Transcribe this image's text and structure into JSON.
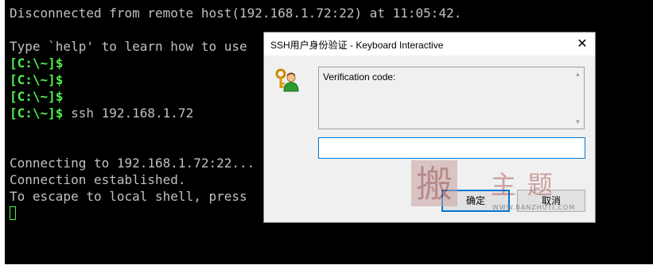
{
  "terminal": {
    "lines": [
      "Disconnected from remote host(192.168.1.72:22) at 11:05:42.",
      "",
      "Type `help' to learn how to use Xshell prompt.",
      "[C:\\~]$",
      "[C:\\~]$",
      "[C:\\~]$",
      "[C:\\~]$ ssh 192.168.1.72",
      "",
      "",
      "Connecting to 192.168.1.72:22...",
      "Connection established.",
      "To escape to local shell, press 'Ctrl+Alt+]'."
    ],
    "prompt": "[C:\\~]$",
    "ssh_command": " ssh 192.168.1.72",
    "line_disconnected": "Disconnected from remote host(192.168.1.72:22) at 11:05:42.",
    "line_help": "Type `help' to learn how to use ",
    "line_connecting": "Connecting to 192.168.1.72:22...",
    "line_established": "Connection established.",
    "line_escape": "To escape to local shell, press ",
    "prompt_color": "#4ef04e",
    "text_color": "#c0c0c0",
    "background": "#000000"
  },
  "dialog": {
    "title": "SSH用户身份验证 - Keyboard Interactive",
    "close_label": "✕",
    "icon": "user-key-icon",
    "message": "Verification code:",
    "input_value": "",
    "ok_label": "确定",
    "cancel_label": "取消",
    "accent_color": "#0078d7"
  },
  "watermark": {
    "seal_text": "搬",
    "text": "主题",
    "url": "WWW.BANZHUTI.COM"
  }
}
